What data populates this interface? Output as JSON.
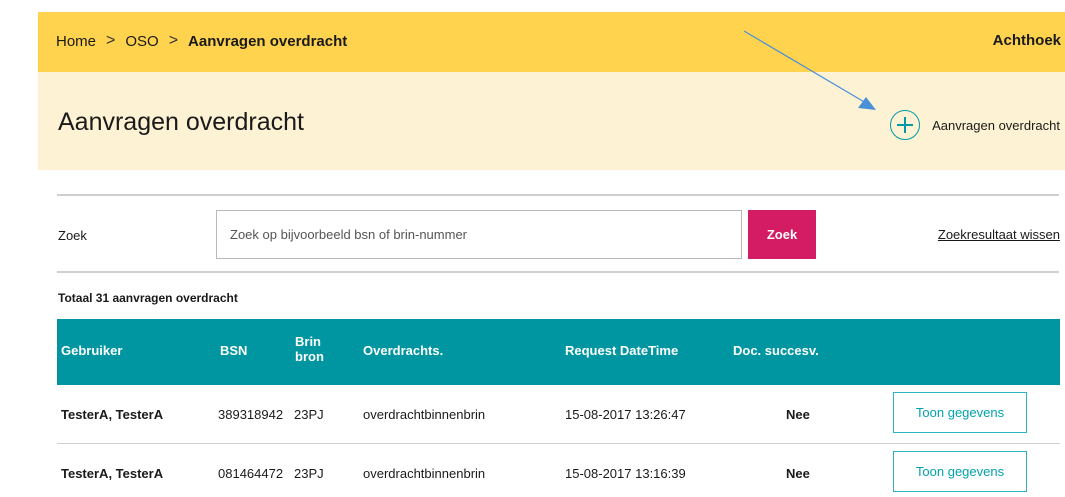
{
  "breadcrumb": {
    "home": "Home",
    "separator": ">",
    "oso": "OSO",
    "current": "Aanvragen overdracht"
  },
  "user": "Achthoek",
  "page": {
    "title": "Aanvragen overdracht",
    "add_label": "Aanvragen overdracht"
  },
  "search": {
    "label": "Zoek",
    "placeholder": "Zoek op bijvoorbeeld bsn of brin-nummer",
    "button": "Zoek",
    "clear": "Zoekresultaat wissen"
  },
  "total": "Totaal 31 aanvragen overdracht",
  "table": {
    "headers": {
      "gebruiker": "Gebruiker",
      "bsn": "BSN",
      "brin_line1": "Brin",
      "brin_line2": "bron",
      "overdrachts": "Overdrachts.",
      "datetime": "Request DateTime",
      "doc": "Doc. succesv."
    },
    "rows": [
      {
        "gebruiker": "TesterA, TesterA",
        "bsn": "389318942",
        "brin": "23PJ",
        "overdrachts": "overdrachtbinnenbrin",
        "datetime": "15-08-2017 13:26:47",
        "doc": "Nee",
        "action": "Toon gegevens"
      },
      {
        "gebruiker": "TesterA, TesterA",
        "bsn": "081464472",
        "brin": "23PJ",
        "overdrachts": "overdrachtbinnenbrin",
        "datetime": "15-08-2017 13:16:39",
        "doc": "Nee",
        "action": "Toon gegevens"
      }
    ]
  },
  "colors": {
    "topbar": "#ffd34e",
    "header": "#fdf3d4",
    "accent_teal": "#0096a1",
    "search_button": "#d31c63",
    "annotation_arrow": "#4a90d9"
  }
}
